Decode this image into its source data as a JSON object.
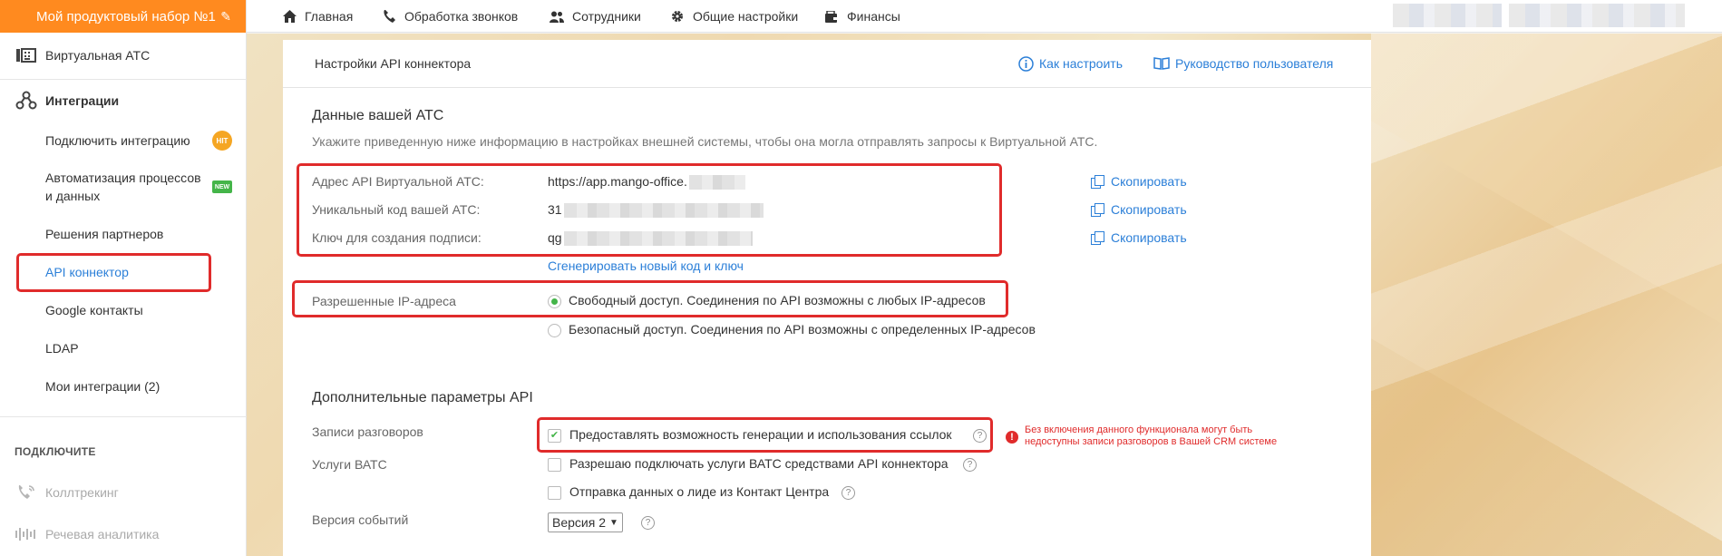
{
  "product": {
    "title": "Мой продуктовый набор №1"
  },
  "topnav": {
    "items": [
      {
        "label": "Главная",
        "icon": "home-icon"
      },
      {
        "label": "Обработка звонков",
        "icon": "phone-icon"
      },
      {
        "label": "Сотрудники",
        "icon": "users-icon"
      },
      {
        "label": "Общие настройки",
        "icon": "gear-icon"
      },
      {
        "label": "Финансы",
        "icon": "wallet-icon"
      }
    ]
  },
  "sidebar": {
    "vats": "Виртуальная АТС",
    "integrations": "Интеграции",
    "sub": [
      {
        "label": "Подключить интеграцию",
        "badge": "HIT"
      },
      {
        "label": "Автоматизация процессов",
        "label2": "и данных",
        "badge": "NEW"
      },
      {
        "label": "Решения партнеров"
      },
      {
        "label": "API коннектор",
        "active": true
      },
      {
        "label": "Google контакты"
      },
      {
        "label": "LDAP"
      },
      {
        "label": "Мои интеграции (2)"
      }
    ],
    "connect_title": "ПОДКЛЮЧИТЕ",
    "calltracking": "Коллтрекинг",
    "speech": "Речевая аналитика"
  },
  "panel": {
    "title": "Настройки API коннектора",
    "how_to": "Как настроить",
    "guide": "Руководство пользователя",
    "section1": {
      "title": "Данные вашей АТС",
      "description": "Укажите приведенную ниже информацию в настройках внешней системы, чтобы она могла отправлять запросы к Виртуальной АТС.",
      "fields": [
        {
          "label": "Адрес API Виртуальной АТС:",
          "value": "https://app.mango-office.",
          "copy": "Скопировать"
        },
        {
          "label": "Уникальный код вашей АТС:",
          "value": "31",
          "copy": "Скопировать"
        },
        {
          "label": "Ключ для создания подписи:",
          "value": "qg",
          "copy": "Скопировать"
        }
      ],
      "generate_link": "Сгенерировать новый код и ключ"
    },
    "ip": {
      "label": "Разрешенные IP-адреса",
      "options": [
        {
          "label": "Свободный доступ. Соединения по API возможны с любых IP-адресов",
          "selected": true
        },
        {
          "label": "Безопасный доступ. Соединения по API возможны с определенных IP-адресов",
          "selected": false
        }
      ]
    },
    "section2": {
      "title": "Дополнительные параметры API",
      "records_label": "Записи разговоров",
      "records_option": "Предоставлять возможность генерации и использования ссылок",
      "records_checked": true,
      "warning": "Без включения данного функционала могут быть недоступны записи разговоров в Вашей CRM системе",
      "services_label": "Услуги ВАТС",
      "services_option": "Разрешаю подключать услуги ВАТС средствами API коннектора",
      "lead_option": "Отправка данных о лиде из Контакт Центра",
      "events_label": "Версия событий",
      "events_value": "Версия 2"
    }
  },
  "colors": {
    "accent": "#ff8a1f",
    "link": "#2b7fd8",
    "highlight": "#e02b2b",
    "ok": "#44b549"
  }
}
